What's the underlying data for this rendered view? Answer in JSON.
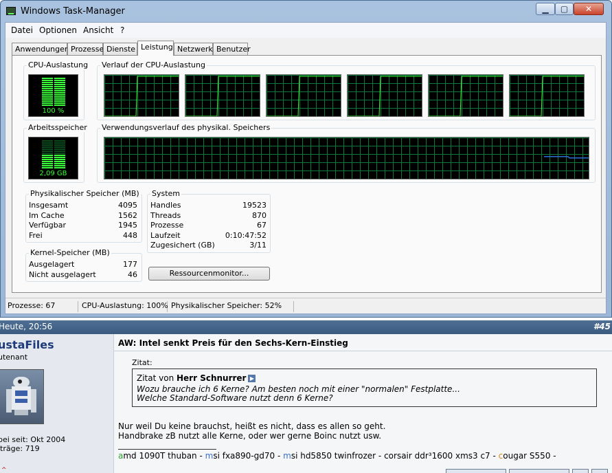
{
  "window": {
    "title": "Windows Task-Manager",
    "min_glyph": "▁",
    "max_glyph": "▢",
    "close_glyph": "✕"
  },
  "menu": [
    "Datei",
    "Optionen",
    "Ansicht",
    "?"
  ],
  "tabs": [
    "Anwendungen",
    "Prozesse",
    "Dienste",
    "Leistung",
    "Netzwerk",
    "Benutzer"
  ],
  "active_tab": "Leistung",
  "performance": {
    "cpu_usage_title": "CPU-Auslastung",
    "cpu_usage_value": "100 %",
    "cpu_usage_fraction": 1.0,
    "cpu_history_title": "Verlauf der CPU-Auslastung",
    "cpu_core_count": 6,
    "memory_title": "Arbeitsspeicher",
    "memory_value": "2,09 GB",
    "memory_fraction": 0.52,
    "memory_history_title": "Verwendungsverlauf des physikal. Speichers"
  },
  "physical_memory": {
    "title": "Physikalischer Speicher (MB)",
    "rows": [
      {
        "label": "Insgesamt",
        "value": "4095"
      },
      {
        "label": "Im Cache",
        "value": "1562"
      },
      {
        "label": "Verfügbar",
        "value": "1945"
      },
      {
        "label": "Frei",
        "value": "448"
      }
    ]
  },
  "system": {
    "title": "System",
    "rows": [
      {
        "label": "Handles",
        "value": "19523"
      },
      {
        "label": "Threads",
        "value": "870"
      },
      {
        "label": "Prozesse",
        "value": "67"
      },
      {
        "label": "Laufzeit",
        "value": "0:10:47:52"
      },
      {
        "label": "Zugesichert (GB)",
        "value": "3/11"
      }
    ]
  },
  "kernel_memory": {
    "title": "Kernel-Speicher (MB)",
    "rows": [
      {
        "label": "Ausgelagert",
        "value": "177"
      },
      {
        "label": "Nicht ausgelagert",
        "value": "46"
      }
    ]
  },
  "resource_monitor_button": "Ressourcenmonitor...",
  "status": {
    "processes": "Prozesse: 67",
    "cpu": "CPU-Auslastung: 100%",
    "memory": "Physikalischer Speicher: 52%"
  },
  "colors": {
    "graph_grid": "#0b7a3a",
    "graph_line": "#39ff39",
    "memory_line": "#2a6fd6"
  },
  "forum": {
    "timestamp": "Heute, 20:56",
    "post_number": "#45",
    "username": "ustaFiles",
    "user_title": "utenant",
    "joined": "bei seit: Okt 2004",
    "post_count": "iträge: 719",
    "post_title": "AW: Intel senkt Preis für den Sechs-Kern-Einstieg",
    "quote_label": "Zitat:",
    "quote_prefix": "Zitat von ",
    "quote_author": "Herr Schnurrer",
    "quote_line1": "Wozu brauche ich 6 Kerne? Am besten noch mit einer \"normalen\" Festplatte...",
    "quote_line2": "Welche Standard-Software nutzt denn 6 Kerne?",
    "body_line1": "Nur weil Du keine brauchst, heißt es nicht, dass es allen so geht.",
    "body_line2": "Handbrake zB nutzt alle Kerne, oder wer gerne Boinc nutzt usw.",
    "signature": [
      {
        "text": "a",
        "color": "green"
      },
      {
        "text": "md 1090T thuban - ",
        "color": "black"
      },
      {
        "text": "m",
        "color": "blue"
      },
      {
        "text": "si fxa890-gd70 - ",
        "color": "black"
      },
      {
        "text": "m",
        "color": "blue"
      },
      {
        "text": "si hd5850 twinfrozer - ",
        "color": "black"
      },
      {
        "text": "c",
        "color": "black"
      },
      {
        "text": "orsair ddr³1600 xms3 c7 - ",
        "color": "black"
      },
      {
        "text": "c",
        "color": "orange"
      },
      {
        "text": "ougar S550 -",
        "color": "black"
      }
    ]
  }
}
